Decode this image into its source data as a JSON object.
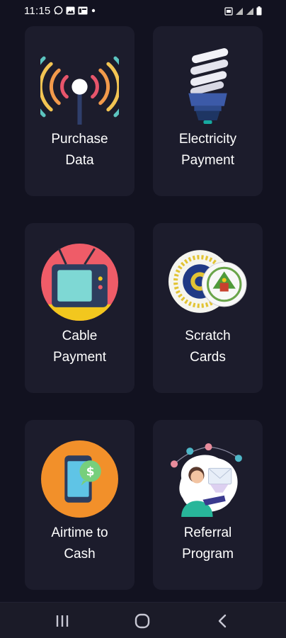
{
  "status_bar": {
    "time": "11:15"
  },
  "tiles": [
    {
      "line1": "Purchase",
      "line2": "Data"
    },
    {
      "line1": "Electricity",
      "line2": "Payment"
    },
    {
      "line1": "Cable",
      "line2": "Payment"
    },
    {
      "line1": "Scratch",
      "line2": "Cards"
    },
    {
      "line1": "Airtime to",
      "line2": "Cash"
    },
    {
      "line1": "Referral",
      "line2": "Program"
    }
  ],
  "nav_bar": {
    "recents": "recents-icon",
    "home": "home-icon",
    "back": "back-icon"
  },
  "colors": {
    "background": "#121220",
    "tile": "#1c1c2c",
    "text": "#ffffff"
  }
}
